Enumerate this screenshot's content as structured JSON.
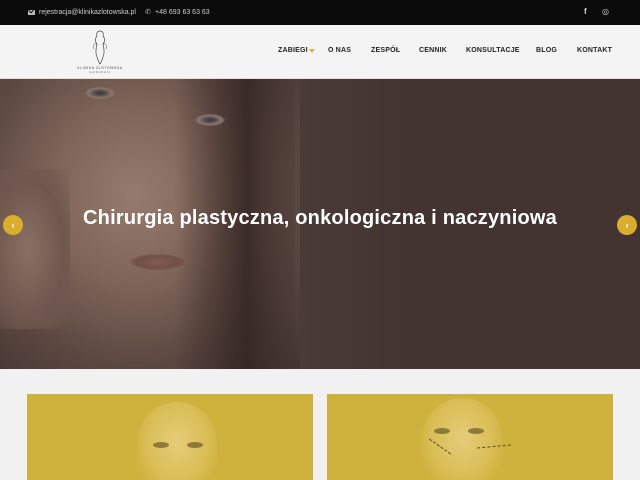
{
  "topbar": {
    "email": "rejestracja@klinikazlotowska.pl",
    "phone": "+48 693 63 63 63",
    "social": [
      "facebook-icon",
      "instagram-icon"
    ],
    "facebook_glyph": "f",
    "instagram_glyph": "◎"
  },
  "header": {
    "logo_text": "KLINIKA ZŁOTOWSKA",
    "logo_subtext": "CHIRURGIA",
    "nav": [
      {
        "label": "ZABIEGI",
        "has_dropdown": true
      },
      {
        "label": "O NAS"
      },
      {
        "label": "ZESPÓŁ"
      },
      {
        "label": "CENNIK"
      },
      {
        "label": "KONSULTACJE"
      },
      {
        "label": "BLOG"
      },
      {
        "label": "KONTAKT"
      }
    ]
  },
  "hero": {
    "title": "Chirurgia plastyczna, onkologiczna i naczyniowa",
    "prev_label": "‹",
    "next_label": "›"
  },
  "colors": {
    "accent": "#d9ae2f",
    "topbar": "#0b0b0b",
    "card": "#cfb13d"
  }
}
